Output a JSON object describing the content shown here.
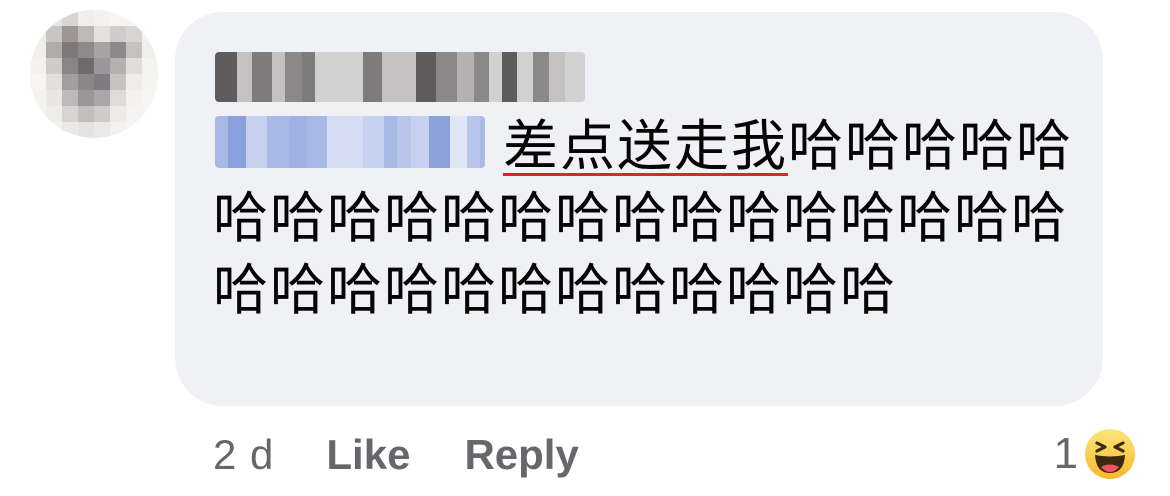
{
  "comment": {
    "author_name": "",
    "tagged_user": "",
    "text_underlined": "差点送走我",
    "text_rest": "哈哈哈哈哈哈哈哈哈哈哈哈哈哈哈哈哈哈哈哈哈哈哈哈哈哈哈哈哈哈哈哈",
    "underline_color": "#e0242a",
    "bubble_color": "#eff1f4"
  },
  "footer": {
    "time": "2 d",
    "like_label": "Like",
    "reply_label": "Reply"
  },
  "reactions": {
    "count": "1",
    "icon": "haha-emoji-icon"
  }
}
